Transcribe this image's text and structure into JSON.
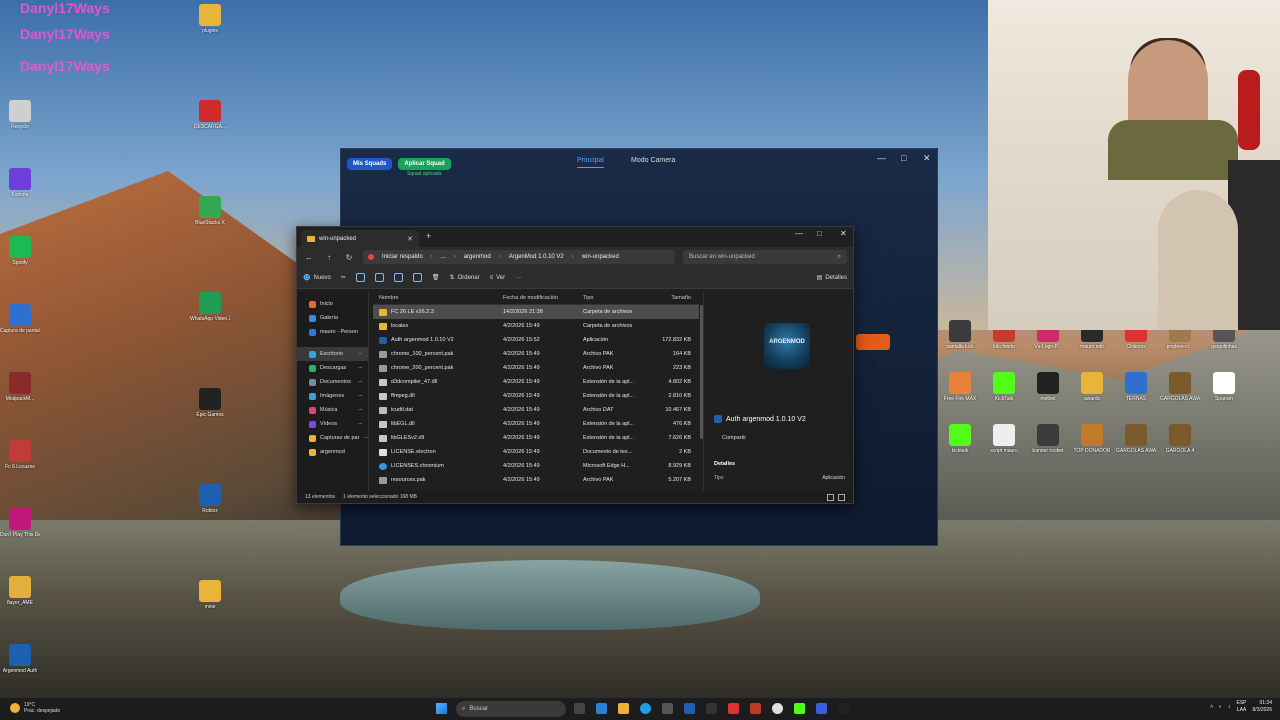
{
  "desktop": {
    "overlay_text": [
      "Danyl17Ways",
      "Danyl17Ways",
      "Danyl17Ways"
    ],
    "icons_left": [
      {
        "label": "Recycle",
        "color": "#cfcfcf"
      },
      {
        "label": "Fortnite",
        "color": "#6b3fd8"
      },
      {
        "label": "Spotify",
        "color": "#1db954"
      },
      {
        "label": "Captura de pantalla",
        "color": "#2f6fd0"
      },
      {
        "label": "ModpackM...",
        "color": "#8a2a2a"
      },
      {
        "label": "Fc 6 Locazos",
        "color": "#c23a3a"
      },
      {
        "label": "Don't Play This Demo",
        "color": "#c2187a"
      },
      {
        "label": "flayer_AME",
        "color": "#e0b03a"
      },
      {
        "label": "Argenmod Auth",
        "color": "#1f5fb0"
      }
    ],
    "icons_mid": [
      {
        "label": "plugins",
        "color": "#e8b43a"
      },
      {
        "label": "DESCARGA...",
        "color": "#d02a2a"
      },
      {
        "label": "BlueStacks X",
        "color": "#33a852"
      },
      {
        "label": "WhatsApp Video 2025",
        "color": "#1f9d55"
      },
      {
        "label": "Epic Games",
        "color": "#222222"
      },
      {
        "label": "Roblox",
        "color": "#1f5fb0"
      },
      {
        "label": "mine",
        "color": "#e8b43a"
      }
    ],
    "icons_right": [
      {
        "label": "pantalla kick",
        "color": "#3b3b3b"
      },
      {
        "label": "lolo fondo",
        "color": "#c33c2e"
      },
      {
        "label": "Vs-Logo-P...",
        "color": "#d02a6a"
      },
      {
        "label": "mauro edit",
        "color": "#2a2a2a"
      },
      {
        "label": "Chilenos",
        "color": "#d33"
      },
      {
        "label": "pngtree-cr...",
        "color": "#9c7c4c"
      },
      {
        "label": "gargolinhas",
        "color": "#555555"
      },
      {
        "label": "Free Fire MAX",
        "color": "#e8813a"
      },
      {
        "label": "KickTalk",
        "color": "#53fc18"
      },
      {
        "label": "melbet",
        "color": "#222222"
      },
      {
        "label": "awards",
        "color": "#e8b43a"
      },
      {
        "label": "TERNAS",
        "color": "#2f6fd0"
      },
      {
        "label": "GARGOLAS AWARDS",
        "color": "#7a5a2a"
      },
      {
        "label": "Spanish",
        "color": "#ffffff"
      },
      {
        "label": "kicktalk",
        "color": "#53fc18"
      },
      {
        "label": "script mauro",
        "color": "#eeeeee"
      },
      {
        "label": "banner roobet",
        "color": "#3b3b3b"
      },
      {
        "label": "TOP DONADOR",
        "color": "#c07a2a"
      },
      {
        "label": "GARGOLAS AWARSD",
        "color": "#7a5a2a"
      },
      {
        "label": "GARGOLA 4",
        "color": "#7a5a2a"
      }
    ]
  },
  "app_window": {
    "badge_1": "Mis Squads",
    "badge_2": "Aplicar Squad",
    "badge_status": "Squad aplicada",
    "tab_main": "Principal",
    "tab_camera": "Modo Camera",
    "controls": {
      "min": "—",
      "max": "□",
      "close": "✕"
    }
  },
  "explorer": {
    "tab_title": "win-unpacked",
    "tab_close": "✕",
    "new_tab": "+",
    "win_min": "—",
    "win_max": "□",
    "win_close": "✕",
    "breadcrumb": [
      "Iniciar respaldo",
      "...",
      "argenmod",
      "ArgenMod 1.0.10 V2",
      "win-unpacked"
    ],
    "search_placeholder": "Buscar en win-unpacked",
    "toolbar": {
      "new_label": "Nuevo",
      "sort_label": "Ordenar",
      "view_label": "Ver",
      "more_label": "···",
      "details_label": "Detalles"
    },
    "nav": {
      "home": "Inicio",
      "gallery": "Galería",
      "personal": "mauro - Person",
      "desktop": "Escritorio",
      "downloads": "Descargas",
      "documents": "Documentos",
      "images": "Imágenes",
      "music": "Música",
      "videos": "Vídeos",
      "captures": "Capturas de par",
      "argenmod": "argenmod"
    },
    "columns": {
      "name": "Nombre",
      "date": "Fecha de modificación",
      "type": "Tipo",
      "size": "Tamaño"
    },
    "files": [
      {
        "name": "FC 26 LE v26.2.3",
        "date": "14/2/2026 21:38",
        "type": "Carpeta de archivos",
        "size": "",
        "kind": "folder"
      },
      {
        "name": "locales",
        "date": "4/2/2026 15:49",
        "type": "Carpeta de archivos",
        "size": "",
        "kind": "folder"
      },
      {
        "name": "Auth argenmod 1.0.10 V2",
        "date": "4/2/2026 15:52",
        "type": "Aplicación",
        "size": "172.832 KB",
        "kind": "app"
      },
      {
        "name": "chrome_100_percent.pak",
        "date": "4/2/2026 15:49",
        "type": "Archivo PAK",
        "size": "164 KB",
        "kind": "pak"
      },
      {
        "name": "chrome_200_percent.pak",
        "date": "4/2/2026 15:49",
        "type": "Archivo PAK",
        "size": "223 KB",
        "kind": "pak"
      },
      {
        "name": "d3dcompiler_47.dll",
        "date": "4/2/2026 15:49",
        "type": "Extensión de la apl...",
        "size": "4.802 KB",
        "kind": "dll"
      },
      {
        "name": "ffmpeg.dll",
        "date": "4/2/2026 15:49",
        "type": "Extensión de la apl...",
        "size": "2.810 KB",
        "kind": "dll"
      },
      {
        "name": "icudtl.dat",
        "date": "4/2/2026 15:49",
        "type": "Archivo DAT",
        "size": "10.467 KB",
        "kind": "dat"
      },
      {
        "name": "libEGL.dll",
        "date": "4/2/2026 15:49",
        "type": "Extensión de la apl...",
        "size": "476 KB",
        "kind": "dll"
      },
      {
        "name": "libGLESv2.dll",
        "date": "4/2/2026 15:49",
        "type": "Extensión de la apl...",
        "size": "7.626 KB",
        "kind": "dll"
      },
      {
        "name": "LICENSE.electron",
        "date": "4/2/2026 15:49",
        "type": "Documento de tex...",
        "size": "2 KB",
        "kind": "elec"
      },
      {
        "name": "LICENSES.chromium",
        "date": "4/2/2026 15:49",
        "type": "Microsoft Edge H...",
        "size": "8.929 KB",
        "kind": "edge"
      },
      {
        "name": "resources.pak",
        "date": "4/2/2026 15:49",
        "type": "Archivo PAK",
        "size": "5.207 KB",
        "kind": "pak"
      }
    ],
    "details": {
      "logo_text": "ARGENMOD",
      "title": "Auth argenmod 1.0.10 V2",
      "share": "Compartir",
      "section": "Detalles",
      "key": "Tipo",
      "value": "Aplicación"
    },
    "status": {
      "count": "13 elementos",
      "selection": "1 elemento seleccionado 168 MB"
    }
  },
  "taskbar": {
    "weather_temp": "19°C",
    "weather_desc": "Prac. despejado",
    "search_label": "Buscar",
    "lang_1": "ESP",
    "lang_2": "LAA",
    "time": "01:34",
    "date": "8/3/2026"
  }
}
